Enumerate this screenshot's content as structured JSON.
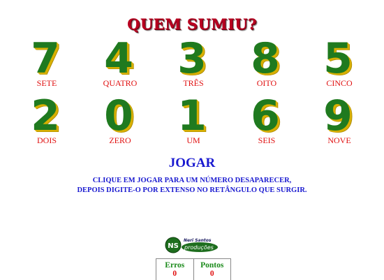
{
  "title": "QUEM SUMIU?",
  "colors": {
    "digit_face": "#1f7a1f",
    "digit_side": "#d8b000",
    "word": "#e01010",
    "title": "#b80020",
    "action": "#1a1ad0",
    "score_label": "#1a8a1a"
  },
  "cards": [
    {
      "digit": "7",
      "word": "SETE"
    },
    {
      "digit": "4",
      "word": "QUATRO"
    },
    {
      "digit": "3",
      "word": "TRÊS"
    },
    {
      "digit": "8",
      "word": "OITO"
    },
    {
      "digit": "5",
      "word": "CINCO"
    },
    {
      "digit": "2",
      "word": "DOIS"
    },
    {
      "digit": "0",
      "word": "ZERO"
    },
    {
      "digit": "1",
      "word": "UM"
    },
    {
      "digit": "6",
      "word": "SEIS"
    },
    {
      "digit": "9",
      "word": "NOVE"
    }
  ],
  "play_label": "JOGAR",
  "instructions": {
    "line1": "CLIQUE EM JOGAR PARA UM NÚMERO DESAPARECER,",
    "line2": "DEPOIS DIGITE-O POR EXTENSO NO RETÂNGULO QUE SURGIR."
  },
  "logo": {
    "initials": "NS",
    "author": "Neri Santos",
    "tag": "produções"
  },
  "score": {
    "errors_label": "Erros",
    "errors_value": "0",
    "points_label": "Pontos",
    "points_value": "0"
  }
}
